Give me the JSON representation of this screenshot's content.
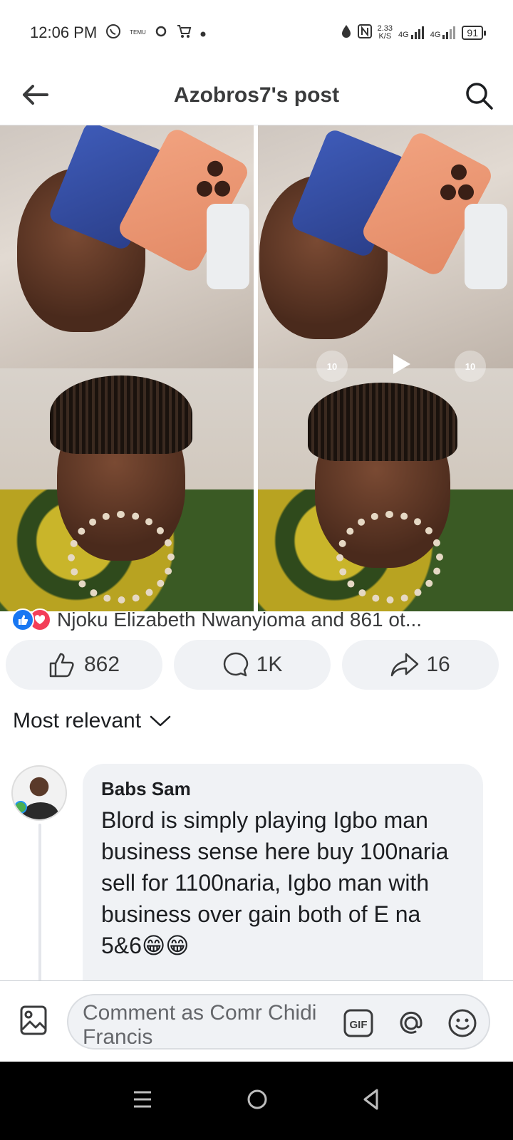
{
  "status_bar": {
    "time": "12:06 PM",
    "temu_label": "TEMU",
    "net_speed": "2.33",
    "net_unit": "K/S",
    "sim1": "4G",
    "sim2": "4G",
    "battery": "91"
  },
  "header": {
    "title": "Azobros7's post"
  },
  "post": {
    "video_skip_back": "10",
    "video_skip_forward": "10",
    "reactions_text": "Njoku Elizabeth Nwanyioma and 861 ot...",
    "like_count": "862",
    "comment_count": "1K",
    "share_count": "16"
  },
  "comments": {
    "sort_label": "Most relevant",
    "items": [
      {
        "author": "Babs Sam",
        "text": "Blord is simply playing Igbo man business sense here buy 100naria sell for 1100naria, Igbo man with business over gain both of E na 5&6😁😁"
      }
    ]
  },
  "composer": {
    "placeholder": "Comment as Comr Chidi Francis",
    "gif_label": "GIF"
  },
  "colors": {
    "like_blue": "#1877f2",
    "love_red": "#f33e58",
    "pill_bg": "#f0f2f5"
  }
}
